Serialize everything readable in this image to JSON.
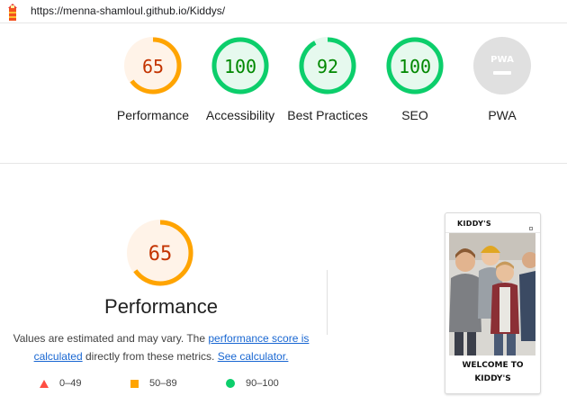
{
  "browser": {
    "url": "https://menna-shamloul.github.io/Kiddys/"
  },
  "colors": {
    "average": "#ffa400",
    "average_text": "#c33300",
    "average_bg": "#fff3e8",
    "pass": "#0cce6b",
    "pass_text": "#008800",
    "pass_bg": "#e6f9ee",
    "fail": "#ff4e42",
    "na": "#e0e0e0",
    "link": "#1967d2"
  },
  "scores": [
    {
      "id": "performance",
      "value": "65",
      "score": 65,
      "label": "Performance",
      "status": "average"
    },
    {
      "id": "accessibility",
      "value": "100",
      "score": 100,
      "label": "Accessibility",
      "status": "pass"
    },
    {
      "id": "best-practices",
      "value": "92",
      "score": 92,
      "label": "Best Practices",
      "status": "pass"
    },
    {
      "id": "seo",
      "value": "100",
      "score": 100,
      "label": "SEO",
      "status": "pass"
    },
    {
      "id": "pwa",
      "value": "",
      "label": "PWA",
      "status": "na",
      "badge_text": "PWA"
    }
  ],
  "performance_section": {
    "score": "65",
    "title": "Performance",
    "desc_prefix": "Values are estimated and may vary. The ",
    "desc_link1": "performance score is calculated",
    "desc_middle": " directly from these metrics. ",
    "desc_link2": "See calculator."
  },
  "legend": [
    {
      "icon": "red-triangle-icon",
      "range": "0–49"
    },
    {
      "icon": "orange-square-icon",
      "range": "50–89"
    },
    {
      "icon": "green-circle-icon",
      "range": "90–100"
    }
  ],
  "preview": {
    "brand": "KIDDY'S",
    "welcome_line1": "WELCOME TO",
    "welcome_line2": "KIDDY'S",
    "image": "kids-photo"
  }
}
